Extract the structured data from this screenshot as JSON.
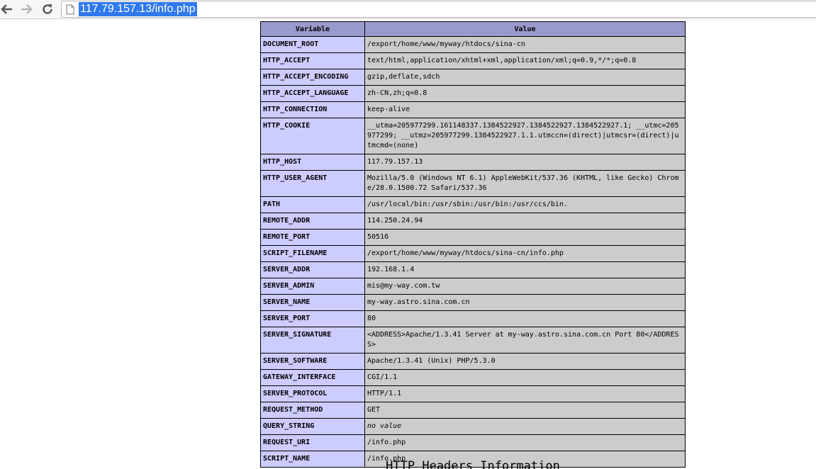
{
  "browser": {
    "url": "117.79.157.13/info.php"
  },
  "table": {
    "headers": {
      "variable": "Variable",
      "value": "Value"
    },
    "rows": [
      {
        "name": "DOCUMENT_ROOT",
        "value": "/export/home/www/myway/htdocs/sina-cn"
      },
      {
        "name": "HTTP_ACCEPT",
        "value": "text/html,application/xhtml+xml,application/xml;q=0.9,*/*;q=0.8"
      },
      {
        "name": "HTTP_ACCEPT_ENCODING",
        "value": "gzip,deflate,sdch"
      },
      {
        "name": "HTTP_ACCEPT_LANGUAGE",
        "value": "zh-CN,zh;q=0.8"
      },
      {
        "name": "HTTP_CONNECTION",
        "value": "keep-alive"
      },
      {
        "name": "HTTP_COOKIE",
        "value": "__utma=205977299.161148337.1384522927.1384522927.1384522927.1; __utmc=205977299; __utmz=205977299.1384522927.1.1.utmccn=(direct)|utmcsr=(direct)|utmcmd=(none)"
      },
      {
        "name": "HTTP_HOST",
        "value": "117.79.157.13"
      },
      {
        "name": "HTTP_USER_AGENT",
        "value": "Mozilla/5.0 (Windows NT 6.1) AppleWebKit/537.36 (KHTML, like Gecko) Chrome/28.0.1500.72 Safari/537.36"
      },
      {
        "name": "PATH",
        "value": "/usr/local/bin:/usr/sbin:/usr/bin:/usr/ccs/bin."
      },
      {
        "name": "REMOTE_ADDR",
        "value": "114.250.24.94"
      },
      {
        "name": "REMOTE_PORT",
        "value": "50516"
      },
      {
        "name": "SCRIPT_FILENAME",
        "value": "/export/home/www/myway/htdocs/sina-cn/info.php"
      },
      {
        "name": "SERVER_ADDR",
        "value": "192.168.1.4"
      },
      {
        "name": "SERVER_ADMIN",
        "value": "mis@my-way.com.tw"
      },
      {
        "name": "SERVER_NAME",
        "value": "my-way.astro.sina.com.cn"
      },
      {
        "name": "SERVER_PORT",
        "value": "80"
      },
      {
        "name": "SERVER_SIGNATURE",
        "value": "<ADDRESS>Apache/1.3.41 Server at my-way.astro.sina.com.cn Port 80</ADDRESS>"
      },
      {
        "name": "SERVER_SOFTWARE",
        "value": "Apache/1.3.41 (Unix) PHP/5.3.0"
      },
      {
        "name": "GATEWAY_INTERFACE",
        "value": "CGI/1.1"
      },
      {
        "name": "SERVER_PROTOCOL",
        "value": "HTTP/1.1"
      },
      {
        "name": "REQUEST_METHOD",
        "value": "GET"
      },
      {
        "name": "QUERY_STRING",
        "value": "no value",
        "italic": true
      },
      {
        "name": "REQUEST_URI",
        "value": "/info.php"
      },
      {
        "name": "SCRIPT_NAME",
        "value": "/info.php"
      }
    ]
  },
  "next_section": {
    "title": "HTTP Headers Information"
  }
}
